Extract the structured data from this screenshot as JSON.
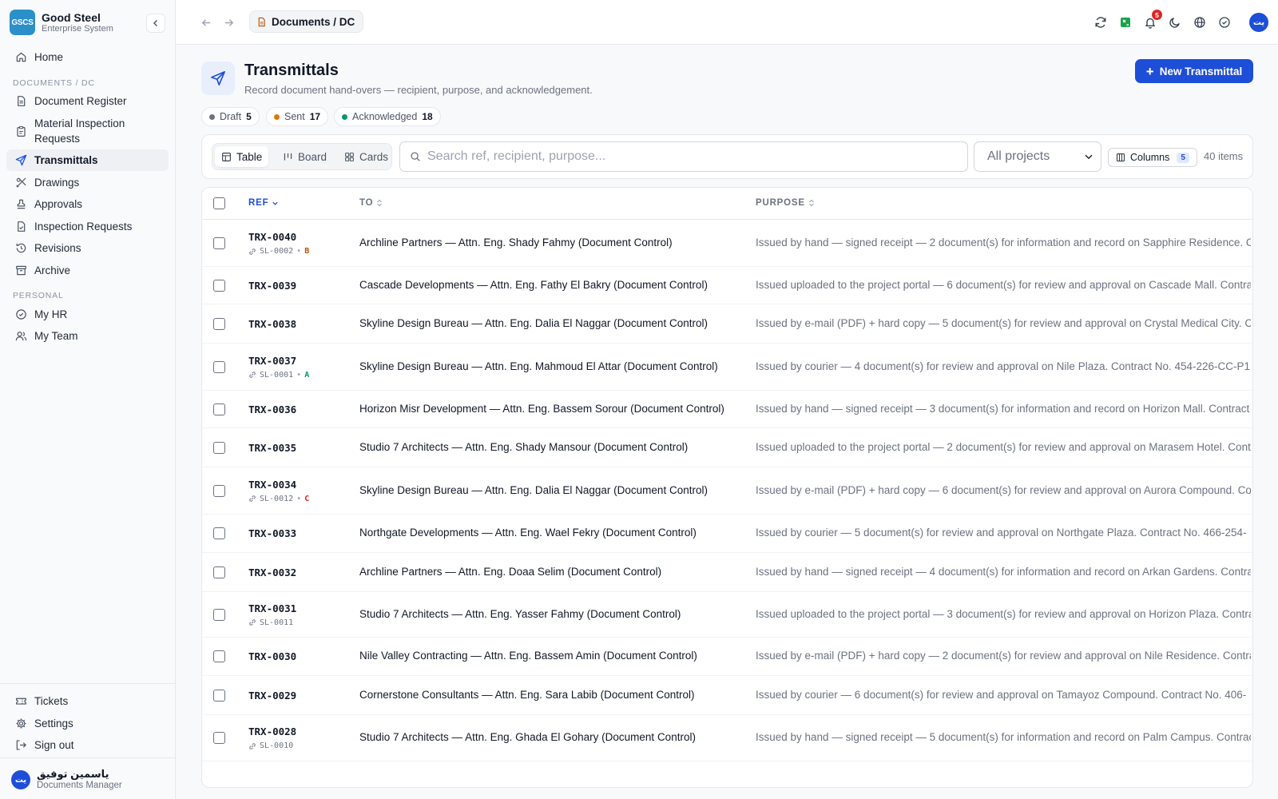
{
  "brand": {
    "logo": "GSCS",
    "name": "Good Steel",
    "subtitle": "Enterprise System"
  },
  "sidebar": {
    "home": "Home",
    "section_documents": "DOCUMENTS / DC",
    "documents": [
      "Document Register",
      "Material Inspection Requests",
      "Transmittals",
      "Drawings",
      "Approvals",
      "Inspection Requests",
      "Revisions",
      "Archive"
    ],
    "section_personal": "PERSONAL",
    "personal": [
      "My HR",
      "My Team"
    ],
    "footer": [
      "Tickets",
      "Settings",
      "Sign out"
    ],
    "user": {
      "initials": "يت",
      "name": "ياسمين توفيق",
      "role": "Documents Manager"
    }
  },
  "topbar": {
    "breadcrumb": "Documents / DC",
    "notifications_count": "5",
    "avatar_initials": "يت"
  },
  "header": {
    "title": "Transmittals",
    "subtitle": "Record document hand-overs — recipient, purpose, and acknowledgement.",
    "new_button": "New Transmittal"
  },
  "status_chips": [
    {
      "label": "Draft",
      "count": "5",
      "color": "#6b7280"
    },
    {
      "label": "Sent",
      "count": "17",
      "color": "#d97706"
    },
    {
      "label": "Acknowledged",
      "count": "18",
      "color": "#059669"
    }
  ],
  "toolbar": {
    "views": [
      "Table",
      "Board",
      "Cards"
    ],
    "active_view": "Table",
    "search_placeholder": "Search ref, recipient, purpose...",
    "project_filter": "All projects",
    "columns_label": "Columns",
    "columns_count": "5",
    "items_count": "40 items"
  },
  "table": {
    "columns": [
      "REF",
      "TO",
      "PURPOSE"
    ],
    "rows": [
      {
        "ref": "TRX-0040",
        "link": "SL-0002",
        "rev": "B",
        "rev_color": "#b45309",
        "to": "Archline Partners — Attn. Eng. Shady Fahmy (Document Control)",
        "purpose": "Issued by hand — signed receipt — 2 document(s) for information and record on Sapphire Residence. Contract"
      },
      {
        "ref": "TRX-0039",
        "link": "",
        "rev": "",
        "to": "Cascade Developments — Attn. Eng. Fathy El Bakry (Document Control)",
        "purpose": "Issued uploaded to the project portal — 6 document(s) for review and approval on Cascade Mall. Contract"
      },
      {
        "ref": "TRX-0038",
        "link": "",
        "rev": "",
        "to": "Skyline Design Bureau — Attn. Eng. Dalia El Naggar (Document Control)",
        "purpose": "Issued by e-mail (PDF) + hard copy — 5 document(s) for review and approval on Crystal Medical City. Contract"
      },
      {
        "ref": "TRX-0037",
        "link": "SL-0001",
        "rev": "A",
        "rev_color": "#059669",
        "to": "Skyline Design Bureau — Attn. Eng. Mahmoud El Attar (Document Control)",
        "purpose": "Issued by courier — 4 document(s) for review and approval on Nile Plaza. Contract No. 454-226-CC-P1"
      },
      {
        "ref": "TRX-0036",
        "link": "",
        "rev": "",
        "to": "Horizon Misr Development — Attn. Eng. Bassem Sorour (Document Control)",
        "purpose": "Issued by hand — signed receipt — 3 document(s) for information and record on Horizon Mall. Contract"
      },
      {
        "ref": "TRX-0035",
        "link": "",
        "rev": "",
        "to": "Studio 7 Architects — Attn. Eng. Shady Mansour (Document Control)",
        "purpose": "Issued uploaded to the project portal — 2 document(s) for review and approval on Marasem Hotel. Contract"
      },
      {
        "ref": "TRX-0034",
        "link": "SL-0012",
        "rev": "C",
        "rev_color": "#dc2626",
        "to": "Skyline Design Bureau — Attn. Eng. Dalia El Naggar (Document Control)",
        "purpose": "Issued by e-mail (PDF) + hard copy — 6 document(s) for review and approval on Aurora Compound. Contract"
      },
      {
        "ref": "TRX-0033",
        "link": "",
        "rev": "",
        "to": "Northgate Developments — Attn. Eng. Wael Fekry (Document Control)",
        "purpose": "Issued by courier — 5 document(s) for review and approval on Northgate Plaza. Contract No. 466-254-"
      },
      {
        "ref": "TRX-0032",
        "link": "",
        "rev": "",
        "to": "Archline Partners — Attn. Eng. Doaa Selim (Document Control)",
        "purpose": "Issued by hand — signed receipt — 4 document(s) for information and record on Arkan Gardens. Contract"
      },
      {
        "ref": "TRX-0031",
        "link": "SL-0011",
        "rev": "",
        "to": "Studio 7 Architects — Attn. Eng. Yasser Fahmy (Document Control)",
        "purpose": "Issued uploaded to the project portal — 3 document(s) for review and approval on Horizon Plaza. Contract"
      },
      {
        "ref": "TRX-0030",
        "link": "",
        "rev": "",
        "to": "Nile Valley Contracting — Attn. Eng. Bassem Amin (Document Control)",
        "purpose": "Issued by e-mail (PDF) + hard copy — 2 document(s) for review and approval on Nile Residence. Contract"
      },
      {
        "ref": "TRX-0029",
        "link": "",
        "rev": "",
        "to": "Cornerstone Consultants — Attn. Eng. Sara Labib (Document Control)",
        "purpose": "Issued by courier — 6 document(s) for review and approval on Tamayoz Compound. Contract No. 406-"
      },
      {
        "ref": "TRX-0028",
        "link": "SL-0010",
        "rev": "",
        "to": "Studio 7 Architects — Attn. Eng. Ghada El Gohary (Document Control)",
        "purpose": "Issued by hand — signed receipt — 5 document(s) for information and record on Palm Campus. Contract"
      }
    ]
  },
  "colors": {
    "accent": "#1d4ed8",
    "brand": "#2b8fc9"
  }
}
